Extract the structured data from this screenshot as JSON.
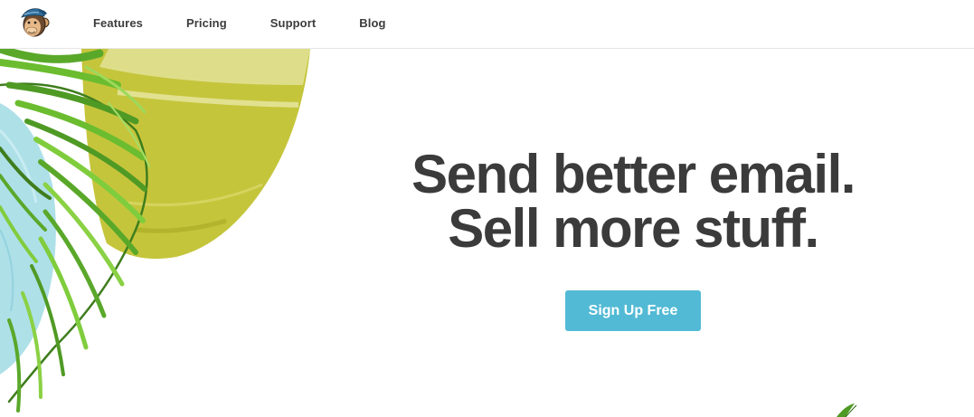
{
  "header": {
    "logo_icon": "monkey-logo-icon",
    "nav": [
      {
        "label": "Features"
      },
      {
        "label": "Pricing"
      },
      {
        "label": "Support"
      },
      {
        "label": "Blog"
      }
    ]
  },
  "hero": {
    "headline_line1": "Send better email.",
    "headline_line2": "Sell more stuff.",
    "cta_label": "Sign Up Free"
  },
  "colors": {
    "cta_background": "#52bad5",
    "headline_text": "#3b3b3b",
    "nav_text": "#3c3c3c",
    "olive_shape": "#c2c23c",
    "light_blue_shape": "#aee0e8",
    "palm_green": "#5aa82a"
  }
}
